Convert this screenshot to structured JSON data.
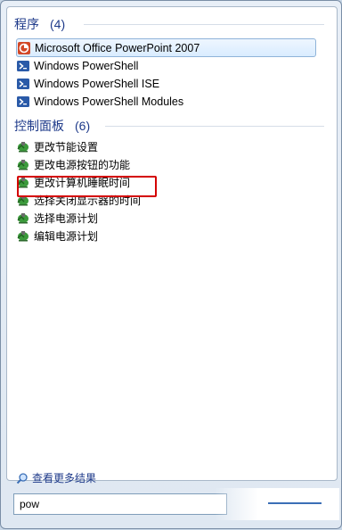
{
  "programs": {
    "header": "程序",
    "count": "(4)",
    "items": [
      {
        "label": "Microsoft Office PowerPoint 2007",
        "icon": "powerpoint-icon"
      },
      {
        "label": "Windows PowerShell",
        "icon": "powershell-icon"
      },
      {
        "label": "Windows PowerShell ISE",
        "icon": "powershell-icon"
      },
      {
        "label": "Windows PowerShell Modules",
        "icon": "powershell-icon"
      }
    ]
  },
  "control_panel": {
    "header": "控制面板",
    "count": "(6)",
    "items": [
      {
        "label": "更改节能设置",
        "icon": "power-options-icon"
      },
      {
        "label": "更改电源按钮的功能",
        "icon": "power-options-icon"
      },
      {
        "label": "更改计算机睡眠时间",
        "icon": "power-options-icon"
      },
      {
        "label": "选择关闭显示器的时间",
        "icon": "power-options-icon"
      },
      {
        "label": "选择电源计划",
        "icon": "power-options-icon"
      },
      {
        "label": "编辑电源计划",
        "icon": "power-options-icon"
      }
    ]
  },
  "footer": {
    "more_results": "查看更多结果"
  },
  "search": {
    "value": "pow"
  },
  "colors": {
    "header_text": "#1e3a8a",
    "highlight_box": "#d40000",
    "selection_bg": "#d9ecff"
  }
}
